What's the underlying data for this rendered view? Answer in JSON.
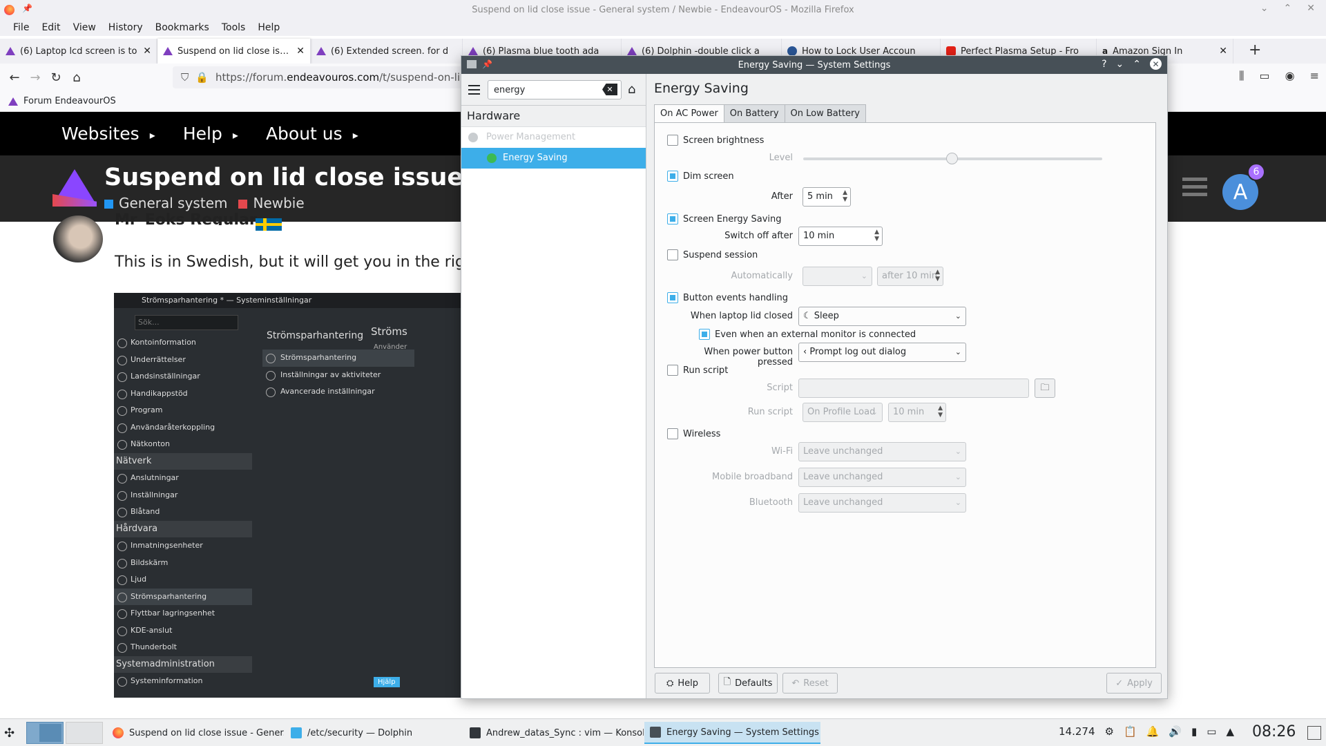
{
  "firefox": {
    "window_title": "Suspend on lid close issue - General system / Newbie - EndeavourOS - Mozilla Firefox",
    "window_controls": [
      "⌄",
      "⌃",
      "✕"
    ],
    "menu": [
      "File",
      "Edit",
      "View",
      "History",
      "Bookmarks",
      "Tools",
      "Help"
    ],
    "tabs": [
      {
        "title": "(6) Laptop lcd screen is to",
        "icon": "endeavouros-icon"
      },
      {
        "title": "Suspend on lid close issue",
        "icon": "endeavouros-icon"
      },
      {
        "title": "(6) Extended screen. for d",
        "icon": "endeavouros-icon"
      },
      {
        "title": "(6) Plasma blue tooth ada",
        "icon": "endeavouros-icon"
      },
      {
        "title": "(6) Dolphin -double click a",
        "icon": "endeavouros-icon"
      },
      {
        "title": "How to Lock User Accoun",
        "icon": "info-icon"
      },
      {
        "title": "Perfect Plasma Setup - Fro",
        "icon": "youtube-icon"
      },
      {
        "title": "Amazon Sign In",
        "icon": "amazon-icon"
      }
    ],
    "url_prefix": "https://forum.",
    "url_domain": "endeavouros.com",
    "url_suffix": "/t/suspend-on-lid-c",
    "bookmark": "Forum EndeavourOS"
  },
  "forum": {
    "nav": [
      "Websites",
      "Help",
      "About us"
    ],
    "topic_title": "Suspend on lid close issue",
    "categories": [
      {
        "name": "General system",
        "color": "#2196f3"
      },
      {
        "name": "Newbie",
        "color": "#e5484d"
      }
    ],
    "user_initial": "A",
    "notifications": "6",
    "post_user": "Mr_Eoks Regular",
    "post_text": "This is in Swedish, but it will get you in the right"
  },
  "embed": {
    "title": "Strömsparhantering * — Systeminställningar",
    "search_placeholder": "Sök...",
    "sidebar": [
      {
        "label": "Kontoinformation"
      },
      {
        "label": "Underrättelser"
      },
      {
        "label": "Landsinställningar"
      },
      {
        "label": "Handikappstöd"
      },
      {
        "label": "Program"
      },
      {
        "label": "Användaråterkoppling"
      },
      {
        "label": "Nätkonton"
      },
      {
        "label": "Nätverk",
        "header": true
      },
      {
        "label": "Anslutningar"
      },
      {
        "label": "Inställningar"
      },
      {
        "label": "Blåtand"
      },
      {
        "label": "Hårdvara",
        "header": true
      },
      {
        "label": "Inmatningsenheter"
      },
      {
        "label": "Bildskärm"
      },
      {
        "label": "Ljud"
      },
      {
        "label": "Strömsparhantering",
        "selected": true
      },
      {
        "label": "Flyttbar lagringsenhet"
      },
      {
        "label": "KDE-anslut"
      },
      {
        "label": "Thunderbolt"
      },
      {
        "label": "Systemadministration",
        "header": true
      },
      {
        "label": "Systeminformation"
      }
    ],
    "mid_title": "Strömsparhantering",
    "mid_items": [
      "Strömsparhantering",
      "Inställningar av aktiviteter",
      "Avancerade inställningar"
    ],
    "right_title": "Ströms",
    "right_sub": "Använder",
    "right_btn": "Hjälp"
  },
  "settings": {
    "window_title": "Energy Saving — System Settings",
    "title_controls": [
      "?",
      "⌄",
      "⌃",
      "✕"
    ],
    "search_value": "energy",
    "category": "Hardware",
    "modules": [
      {
        "label": "Power Management",
        "disabled": true
      },
      {
        "label": "Energy Saving",
        "selected": true
      }
    ],
    "heading": "Energy Saving",
    "tabs": [
      "On AC Power",
      "On Battery",
      "On Low Battery"
    ],
    "screen_brightness": {
      "label": "Screen brightness",
      "checked": false,
      "level_label": "Level",
      "level": 0.5
    },
    "dim_screen": {
      "label": "Dim screen",
      "checked": true,
      "after_label": "After",
      "after_value": "5 min"
    },
    "screen_energy": {
      "label": "Screen Energy Saving",
      "checked": true,
      "switch_label": "Switch off after",
      "switch_value": "10 min"
    },
    "suspend_session": {
      "label": "Suspend session",
      "checked": false,
      "auto_label": "Automatically",
      "auto_value": "",
      "after_value": "after 10 min"
    },
    "button_events": {
      "label": "Button events handling",
      "checked": true,
      "lid_label": "When laptop lid closed",
      "lid_value": "Sleep",
      "external_label": "Even when an external monitor is connected",
      "external_checked": true,
      "power_label": "When power button pressed",
      "power_value": "Prompt log out dialog"
    },
    "run_script": {
      "label": "Run script",
      "checked": false,
      "script_label": "Script",
      "run_label": "Run script",
      "run_value": "On Profile Load",
      "time_value": "10 min"
    },
    "wireless": {
      "label": "Wireless",
      "checked": false,
      "wifi_label": "Wi-Fi",
      "wifi_value": "Leave unchanged",
      "mobile_label": "Mobile broadband",
      "mobile_value": "Leave unchanged",
      "bt_label": "Bluetooth",
      "bt_value": "Leave unchanged"
    },
    "buttons": {
      "help": "Help",
      "defaults": "Defaults",
      "reset": "Reset",
      "apply": "Apply"
    }
  },
  "taskbar": {
    "tasks": [
      {
        "label": "Suspend on lid close issue - Gener...",
        "icon": "firefox-icon"
      },
      {
        "label": "/etc/security — Dolphin",
        "icon": "folder-icon"
      },
      {
        "label": "Andrew_datas_Sync : vim — Konsole",
        "icon": "terminal-icon"
      },
      {
        "label": "Energy Saving — System Settings",
        "icon": "settings-icon",
        "active": true
      }
    ],
    "tray_number": "14.274",
    "clock": "08:26"
  },
  "colors": {
    "accent": "#3daee9",
    "forum_purple": "#8a46ff",
    "titlebar": "#475057"
  }
}
